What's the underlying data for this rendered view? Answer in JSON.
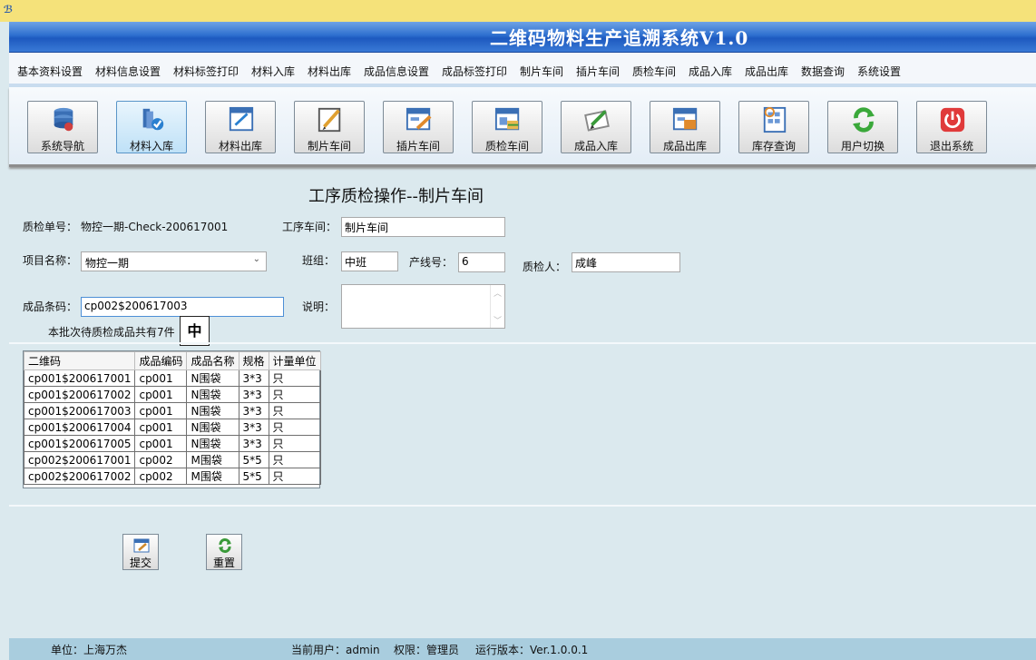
{
  "app": {
    "title": "二维码物料生产追溯系统V1.0"
  },
  "menu": [
    "基本资料设置",
    "材料信息设置",
    "材料标签打印",
    "材料入库",
    "材料出库",
    "成品信息设置",
    "成品标签打印",
    "制片车间",
    "插片车间",
    "质检车间",
    "成品入库",
    "成品出库",
    "数据查询",
    "系统设置"
  ],
  "toolbar": [
    {
      "label": "系统导航",
      "icon": "database-icon"
    },
    {
      "label": "材料入库",
      "icon": "material-in-icon",
      "active": true
    },
    {
      "label": "材料出库",
      "icon": "material-out-icon"
    },
    {
      "label": "制片车间",
      "icon": "edit-doc-icon"
    },
    {
      "label": "插片车间",
      "icon": "insert-doc-icon"
    },
    {
      "label": "质检车间",
      "icon": "inspection-icon"
    },
    {
      "label": "成品入库",
      "icon": "product-in-icon"
    },
    {
      "label": "成品出库",
      "icon": "product-out-icon"
    },
    {
      "label": "库存查询",
      "icon": "inventory-query-icon"
    },
    {
      "label": "用户切换",
      "icon": "refresh-icon"
    },
    {
      "label": "退出系统",
      "icon": "power-icon"
    }
  ],
  "form": {
    "page_title": "工序质检操作--制片车间",
    "check_no_label": "质检单号：",
    "check_no_value": "物控一期-Check-200617001",
    "workshop_label": "工序车间：",
    "workshop_value": "制片车间",
    "project_label": "项目名称：",
    "project_value": "物控一期",
    "team_label": "班组：",
    "team_value": "中班",
    "line_label": "产线号：",
    "line_value": "6",
    "inspector_label": "质检人：",
    "inspector_value": "成峰",
    "barcode_label": "成品条码：",
    "barcode_value": "cp002$200617003",
    "note_label": "说明：",
    "pending_text": "本批次待质检成品共有7件",
    "ime_indicator": "中"
  },
  "grid": {
    "columns": [
      "二维码",
      "成品编码",
      "成品名称",
      "规格",
      "计量单位"
    ],
    "rows": [
      [
        "cp001$200617001",
        "cp001",
        "N围袋",
        "3*3",
        "只"
      ],
      [
        "cp001$200617002",
        "cp001",
        "N围袋",
        "3*3",
        "只"
      ],
      [
        "cp001$200617003",
        "cp001",
        "N围袋",
        "3*3",
        "只"
      ],
      [
        "cp001$200617004",
        "cp001",
        "N围袋",
        "3*3",
        "只"
      ],
      [
        "cp001$200617005",
        "cp001",
        "N围袋",
        "3*3",
        "只"
      ],
      [
        "cp002$200617001",
        "cp002",
        "M围袋",
        "5*5",
        "只"
      ],
      [
        "cp002$200617002",
        "cp002",
        "M围袋",
        "5*5",
        "只"
      ]
    ]
  },
  "actions": {
    "submit_label": "提交",
    "reset_label": "重置"
  },
  "status": {
    "unit": "单位：上海万杰",
    "user": "当前用户：admin",
    "role": "权限：管理员",
    "version": "运行版本：Ver.1.0.0.1"
  }
}
